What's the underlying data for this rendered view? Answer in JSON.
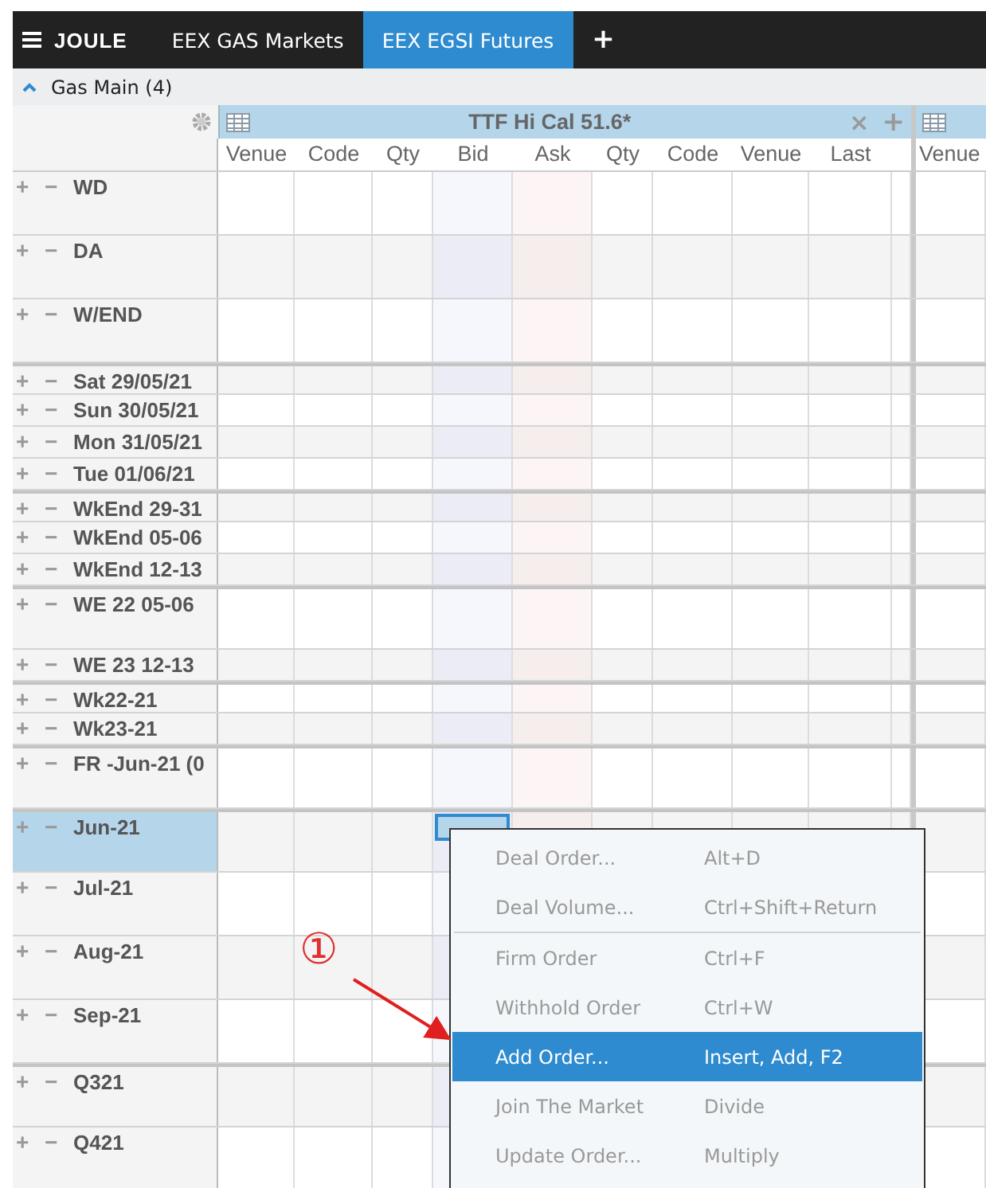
{
  "topbar": {
    "brand": "JOULE",
    "tabs": [
      {
        "label": "EEX GAS Markets",
        "selected": false
      },
      {
        "label": "EEX EGSI Futures",
        "selected": true
      }
    ],
    "add_tab": "+"
  },
  "group": {
    "title": "Gas Main (4)",
    "expanded": true
  },
  "panels": [
    {
      "title": "TTF Hi Cal 51.6*",
      "close": "×",
      "add": "+",
      "columns": [
        "Venue",
        "Code",
        "Qty",
        "Bid",
        "Ask",
        "Qty",
        "Code",
        "Venue",
        "Last"
      ]
    },
    {
      "columns": [
        "Venue"
      ]
    }
  ],
  "rows": [
    {
      "expand": "+",
      "collapse": "−",
      "label": "WD",
      "kind": "tall",
      "group_start": false,
      "selected": false,
      "focused": false
    },
    {
      "expand": "+",
      "collapse": "−",
      "label": "DA",
      "kind": "tall",
      "group_start": false,
      "selected": false,
      "focused": false
    },
    {
      "expand": "+",
      "collapse": "−",
      "label": "W/END",
      "kind": "tall",
      "group_start": false,
      "selected": false,
      "focused": false
    },
    {
      "expand": "+",
      "collapse": "−",
      "label": "Sat 29/05/21",
      "kind": "short",
      "group_start": true,
      "selected": false,
      "focused": false
    },
    {
      "expand": "+",
      "collapse": "−",
      "label": "Sun 30/05/21",
      "kind": "short",
      "group_start": false,
      "selected": false,
      "focused": false
    },
    {
      "expand": "+",
      "collapse": "−",
      "label": "Mon 31/05/21",
      "kind": "short",
      "group_start": false,
      "selected": false,
      "focused": false
    },
    {
      "expand": "+",
      "collapse": "−",
      "label": "Tue 01/06/21",
      "kind": "short",
      "group_start": false,
      "selected": false,
      "focused": false
    },
    {
      "expand": "+",
      "collapse": "−",
      "label": "WkEnd 29-31",
      "kind": "short",
      "group_start": true,
      "selected": false,
      "focused": false
    },
    {
      "expand": "+",
      "collapse": "−",
      "label": "WkEnd 05-06",
      "kind": "short",
      "group_start": false,
      "selected": false,
      "focused": false
    },
    {
      "expand": "+",
      "collapse": "−",
      "label": "WkEnd 12-13",
      "kind": "short",
      "group_start": false,
      "selected": false,
      "focused": false
    },
    {
      "expand": "+",
      "collapse": "−",
      "label": "WE 22 05-06",
      "kind": "tall",
      "group_start": true,
      "selected": false,
      "focused": false
    },
    {
      "expand": "+",
      "collapse": "−",
      "label": "WE 23 12-13",
      "kind": "short",
      "group_start": false,
      "selected": false,
      "focused": false
    },
    {
      "expand": "+",
      "collapse": "−",
      "label": "Wk22-21",
      "kind": "short",
      "group_start": true,
      "selected": false,
      "focused": false
    },
    {
      "expand": "+",
      "collapse": "−",
      "label": "Wk23-21",
      "kind": "short",
      "group_start": false,
      "selected": false,
      "focused": false
    },
    {
      "expand": "+",
      "collapse": "−",
      "label": "FR -Jun-21 (0",
      "kind": "tall",
      "group_start": true,
      "selected": false,
      "focused": false
    },
    {
      "expand": "+",
      "collapse": "−",
      "label": "Jun-21",
      "kind": "tall",
      "group_start": true,
      "selected": true,
      "focused": true
    },
    {
      "expand": "+",
      "collapse": "−",
      "label": "Jul-21",
      "kind": "tall",
      "group_start": false,
      "selected": false,
      "focused": false
    },
    {
      "expand": "+",
      "collapse": "−",
      "label": "Aug-21",
      "kind": "tall",
      "group_start": false,
      "selected": false,
      "focused": false
    },
    {
      "expand": "+",
      "collapse": "−",
      "label": "Sep-21",
      "kind": "tall",
      "group_start": false,
      "selected": false,
      "focused": false
    },
    {
      "expand": "+",
      "collapse": "−",
      "label": "Q321",
      "kind": "tall",
      "group_start": true,
      "selected": false,
      "focused": false
    },
    {
      "expand": "+",
      "collapse": "−",
      "label": "Q421",
      "kind": "tall",
      "group_start": false,
      "selected": false,
      "focused": false
    }
  ],
  "context_menu": [
    {
      "kind": "item",
      "label": "Deal Order...",
      "shortcut": "Alt+D",
      "disabled": true,
      "selected": false
    },
    {
      "kind": "item",
      "label": "Deal Volume...",
      "shortcut": "Ctrl+Shift+Return",
      "disabled": true,
      "selected": false
    },
    {
      "kind": "separator"
    },
    {
      "kind": "item",
      "label": "Firm Order",
      "shortcut": "Ctrl+F",
      "disabled": true,
      "selected": false
    },
    {
      "kind": "item",
      "label": "Withhold Order",
      "shortcut": "Ctrl+W",
      "disabled": true,
      "selected": false
    },
    {
      "kind": "item",
      "label": "Add Order...",
      "shortcut": "Insert, Add, F2",
      "disabled": false,
      "selected": true
    },
    {
      "kind": "item",
      "label": "Join The Market",
      "shortcut": "Divide",
      "disabled": true,
      "selected": false
    },
    {
      "kind": "item",
      "label": "Update Order...",
      "shortcut": "Multiply",
      "disabled": true,
      "selected": false
    }
  ],
  "annotation": {
    "label": "①"
  }
}
